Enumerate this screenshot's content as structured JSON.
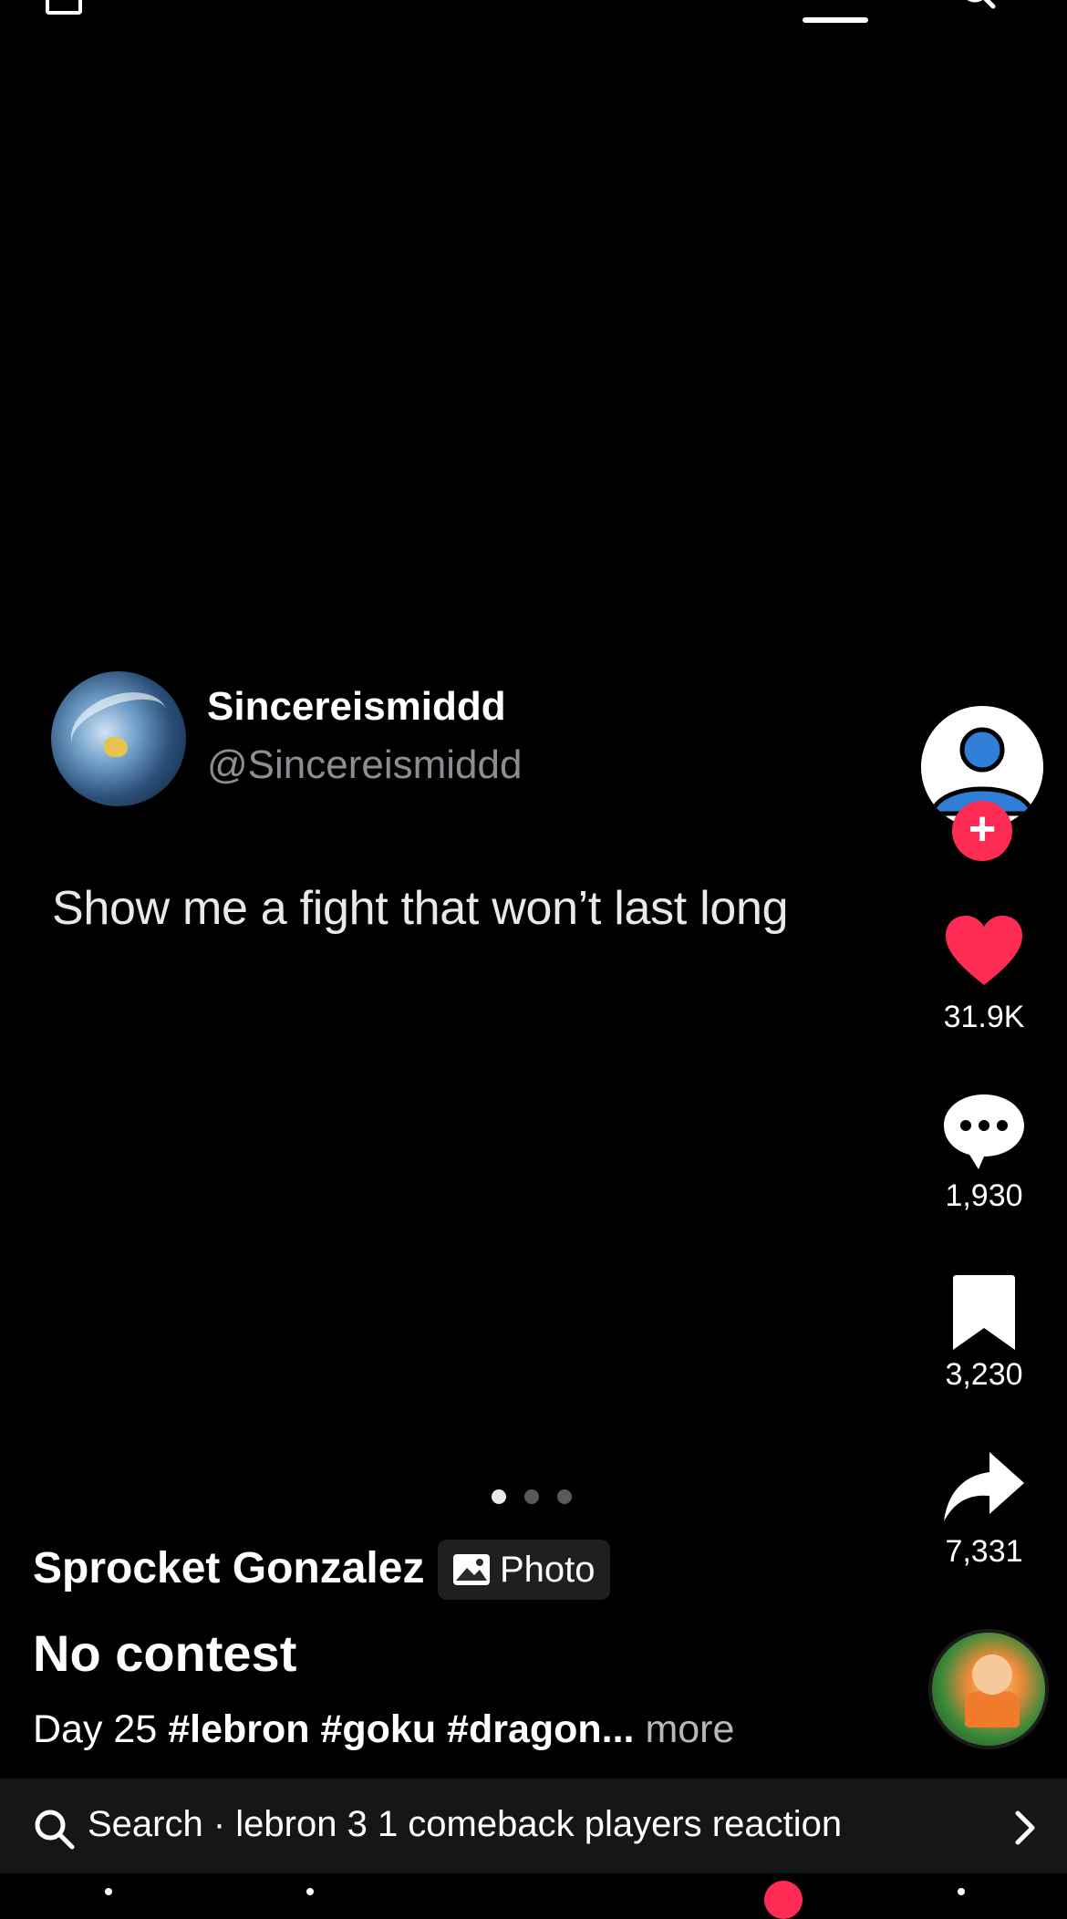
{
  "tweet": {
    "display_name": "Sincereismiddd",
    "handle": "@Sincereismiddd",
    "text": "Show me a fight that won’t last long"
  },
  "carousel": {
    "total": 3,
    "active": 1
  },
  "actions": {
    "likes": "31.9K",
    "comments": "1,930",
    "saves": "3,230",
    "shares": "7,331",
    "follow_symbol": "+"
  },
  "post": {
    "author": "Sprocket Gonzalez",
    "badge_label": "Photo",
    "title": "No contest",
    "desc_prefix": "Day 25 ",
    "desc_tags": "#lebron #goku #dragon...",
    "desc_more": " more"
  },
  "search_suggestion": {
    "text": "Search · lebron 3 1 comeback players reaction"
  },
  "colors": {
    "accent": "#fe2c55",
    "background": "#000000",
    "secondary_text": "#8b8f94"
  },
  "icons": [
    "search-icon",
    "heart-icon",
    "comment-icon",
    "bookmark-icon",
    "share-icon",
    "photo-icon",
    "chevron-right-icon",
    "plus-icon"
  ]
}
